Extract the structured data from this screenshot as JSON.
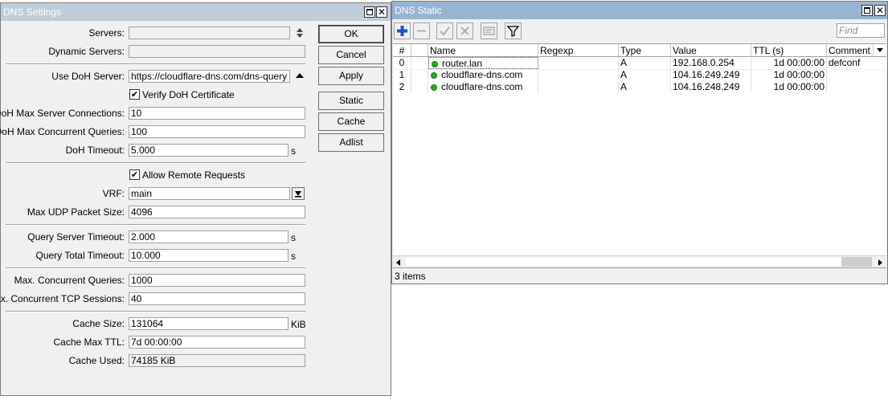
{
  "dns_settings": {
    "title": "DNS Settings",
    "fields": {
      "servers_label": "Servers:",
      "servers_value": "",
      "dynamic_servers_label": "Dynamic Servers:",
      "dynamic_servers_value": "",
      "use_doh_label": "Use DoH Server:",
      "use_doh_value": "https://cloudflare-dns.com/dns-query",
      "verify_doh_label": "Verify DoH Certificate",
      "doh_max_conn_label": "DoH Max Server Connections:",
      "doh_max_conn_value": "10",
      "doh_max_queries_label": "DoH Max Concurrent Queries:",
      "doh_max_queries_value": "100",
      "doh_timeout_label": "DoH Timeout:",
      "doh_timeout_value": "5.000",
      "doh_timeout_unit": "s",
      "allow_remote_label": "Allow Remote Requests",
      "vrf_label": "VRF:",
      "vrf_value": "main",
      "max_udp_label": "Max UDP Packet Size:",
      "max_udp_value": "4096",
      "query_server_timeout_label": "Query Server Timeout:",
      "query_server_timeout_value": "2.000",
      "query_server_timeout_unit": "s",
      "query_total_timeout_label": "Query Total Timeout:",
      "query_total_timeout_value": "10.000",
      "query_total_timeout_unit": "s",
      "max_concurrent_queries_label": "Max. Concurrent Queries:",
      "max_concurrent_queries_value": "1000",
      "max_tcp_sessions_label": "Max. Concurrent TCP Sessions:",
      "max_tcp_sessions_value": "40",
      "cache_size_label": "Cache Size:",
      "cache_size_value": "131064",
      "cache_size_unit": "KiB",
      "cache_max_ttl_label": "Cache Max TTL:",
      "cache_max_ttl_value": "7d 00:00:00",
      "cache_used_label": "Cache Used:",
      "cache_used_value": "74185 KiB"
    },
    "buttons": {
      "ok": "OK",
      "cancel": "Cancel",
      "apply": "Apply",
      "static": "Static",
      "cache": "Cache",
      "adlist": "Adlist"
    }
  },
  "dns_static": {
    "title": "DNS Static",
    "find_placeholder": "Find",
    "columns": [
      "#",
      "Name",
      "Regexp",
      "Type",
      "Value",
      "TTL (s)",
      "Comment"
    ],
    "rows": [
      {
        "num": "0",
        "name": "router.lan",
        "regexp": "",
        "type": "A",
        "value": "192.168.0.254",
        "ttl": "1d 00:00:00",
        "comment": "defconf"
      },
      {
        "num": "1",
        "name": "cloudflare-dns.com",
        "regexp": "",
        "type": "A",
        "value": "104.16.249.249",
        "ttl": "1d 00:00:00",
        "comment": ""
      },
      {
        "num": "2",
        "name": "cloudflare-dns.com",
        "regexp": "",
        "type": "A",
        "value": "104.16.248.249",
        "ttl": "1d 00:00:00",
        "comment": ""
      }
    ],
    "status": "3 items",
    "colors": {
      "enabled_dot": "#22aa22",
      "add_icon": "#1c4fd6"
    }
  }
}
